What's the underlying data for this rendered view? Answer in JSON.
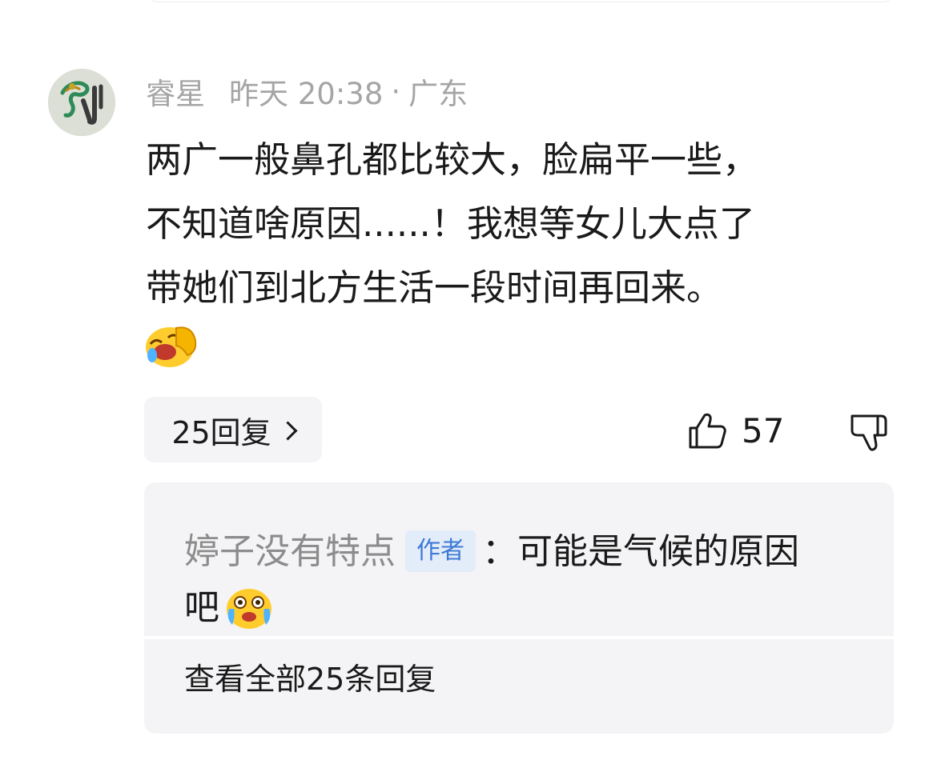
{
  "comment": {
    "username": "睿星",
    "time": "昨天 20:38",
    "separator": "·",
    "location": "广东",
    "lines": [
      "两广一般鼻孔都比较大，脸扁平一些，",
      "不知道啥原因......！我想等女儿大点了",
      "带她们到北方生活一段时间再回来。"
    ],
    "emoji": "laughing-face-emoji",
    "replies_label": "25回复",
    "like_count": "57"
  },
  "reply": {
    "username": "婷子没有特点",
    "badge": "作者",
    "text_part1": "：可能是气候的原因",
    "text_part2": "吧",
    "emoji": "crying-face-emoji",
    "view_all_label": "查看全部25条回复"
  },
  "colors": {
    "meta_gray": "#a5a5a5",
    "pill_bg": "#f4f4f6",
    "badge_bg": "#e3ecf9",
    "badge_text": "#3d7ad6"
  }
}
